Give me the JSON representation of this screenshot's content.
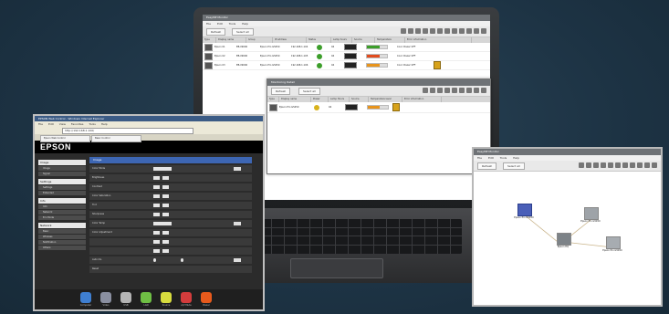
{
  "laptop_app": {
    "title": "EasyMP Monitor",
    "menu": [
      "File",
      "Edit",
      "Tools",
      "Help"
    ],
    "toolbar": {
      "refresh": "Refresh",
      "select_all": "Select all"
    },
    "columns": [
      "Type",
      "Display name",
      "Group",
      "IP address",
      "Status",
      "Lamp hours",
      "Source",
      "Temperature",
      "Error information"
    ],
    "rows": [
      {
        "name": "Epson 01",
        "group": "EB-X9000",
        "model": "Epson Pro G5450",
        "ip": "192.168.1.104",
        "hours": "94",
        "temp_color": "#3c9e2a",
        "info": "Cool: Power OFF",
        "warn": false
      },
      {
        "name": "Epson 02",
        "group": "EB-X9000",
        "model": "Epson Pro G5450",
        "ip": "192.168.1.105",
        "hours": "94",
        "temp_color": "#e24b1d",
        "info": "Cool: Power OFF",
        "warn": false
      },
      {
        "name": "Epson 03",
        "group": "EB-X9000",
        "model": "Epson Pro G5450",
        "ip": "192.168.1.106",
        "hours": "94",
        "temp_color": "#e8941c",
        "info": "Cool: Power OFF",
        "warn": true
      }
    ]
  },
  "dialog": {
    "title": "Monitoring Detail",
    "refresh": "Refresh",
    "select_all": "Select all",
    "columns": [
      "Type",
      "Display name",
      "Power",
      "Lamp Hours",
      "Source",
      "Temperature level",
      "Error information"
    ],
    "row": {
      "name": "Epson Pro G5450",
      "hours": "94"
    }
  },
  "browser": {
    "title": "EPSON Web Control - Windows Internet Explorer",
    "menu": [
      "File",
      "Edit",
      "View",
      "Favorites",
      "Tools",
      "Help"
    ],
    "url": "http://192.168.1.100/",
    "tabs": [
      "Epson Web Control",
      "Basic Control"
    ],
    "brand": "EPSON",
    "sidebar": [
      {
        "header": "Image",
        "items": [
          "Image",
          "Signal"
        ]
      },
      {
        "header": "Settings",
        "items": [
          "Settings",
          "Extended"
        ]
      },
      {
        "header": "Info",
        "items": [
          "Info",
          "Network",
          "Eco Mode"
        ]
      },
      {
        "header": "Network",
        "items": [
          "Basic",
          "Wireless",
          "Notification",
          "Others"
        ]
      }
    ],
    "panel_title": "Image",
    "settings": [
      {
        "label": "Color Mode",
        "kind": "sel",
        "btn": true
      },
      {
        "label": "Brightness",
        "kind": "pm"
      },
      {
        "label": "Contrast",
        "kind": "pm"
      },
      {
        "label": "Color Saturation",
        "kind": "pm"
      },
      {
        "label": "Tint",
        "kind": "pm"
      },
      {
        "label": "Sharpness",
        "kind": "pm"
      },
      {
        "label": "Color Temp",
        "kind": "sel",
        "btn": true
      },
      {
        "label": "Color Adjustment",
        "kind": "pm"
      },
      {
        "label": "",
        "kind": "pm"
      },
      {
        "label": "",
        "kind": "pm"
      },
      {
        "label": "Auto Iris",
        "kind": "radio",
        "btn": true
      },
      {
        "label": "Reset",
        "kind": "none"
      }
    ],
    "dock": [
      {
        "label": "Computer",
        "color": "#3f7fd1"
      },
      {
        "label": "Video",
        "color": "#8a8fa0"
      },
      {
        "label": "USB",
        "color": "#b4b4b4"
      },
      {
        "label": "LAN",
        "color": "#6fbf44"
      },
      {
        "label": "Source",
        "color": "#d7dc3e"
      },
      {
        "label": "A/V Mute",
        "color": "#d33c3c"
      },
      {
        "label": "Power",
        "color": "#e85a1c"
      }
    ]
  },
  "network_app": {
    "title": "EasyMP Monitor",
    "menu": [
      "File",
      "Edit",
      "Tools",
      "Help"
    ],
    "toolbar": {
      "refresh": "Refresh",
      "select_all": "Select all"
    },
    "nodes": [
      {
        "label": "Epson Pro G5450",
        "kind": "selected"
      },
      {
        "label": "Epson Pro G5450",
        "kind": "normal"
      },
      {
        "label": "Epson HQ",
        "kind": "normal"
      },
      {
        "label": "Epson Pro G5450",
        "kind": "normal"
      }
    ]
  }
}
